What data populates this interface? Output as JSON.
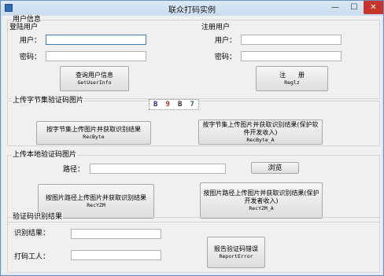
{
  "window": {
    "title": "联众打码实例",
    "controls": {
      "minimize": "—",
      "maximize": "☐",
      "close": "✕"
    }
  },
  "user_info": {
    "group_title": "用户信息",
    "login": {
      "title": "登陆用户",
      "user_label": "用户：",
      "password_label": "密码：",
      "user_value": "",
      "password_value": "",
      "button_label": "查询用户信息",
      "button_sub": "GetUserInfo"
    },
    "register": {
      "title": "注册用户",
      "user_label": "用户：",
      "password_label": "密码：",
      "user_value": "",
      "password_value": "",
      "button_label": "注　　册",
      "button_sub": "Reglz"
    }
  },
  "byte_upload": {
    "title": "上传字节集验证码图片",
    "captcha_chars": [
      "B",
      "9",
      "B",
      "7"
    ],
    "button1_label": "按字节集上传图片并获取识别结果",
    "button1_sub": "RecByte",
    "button2_label": "按字节集上传图片并获取识别结果(保护软件开发收入)",
    "button2_sub": "RecByte_A"
  },
  "local_upload": {
    "title": "上传本地验证码图片",
    "path_label": "路径：",
    "path_value": "",
    "browse_label": "浏览",
    "button1_label": "按图片路径上传图片并获取识别结果",
    "button1_sub": "RecYZM",
    "button2_label": "按图片路径上传图片并获取识别结果(保护开发者收入)",
    "button2_sub": "RecYZM_A"
  },
  "result": {
    "title": "验证码识别结果",
    "result_label": "识别结果：",
    "result_value": "",
    "worker_label": "打码工人：",
    "worker_value": "",
    "report_label": "报告验证码错误",
    "report_sub": "ReportError"
  }
}
